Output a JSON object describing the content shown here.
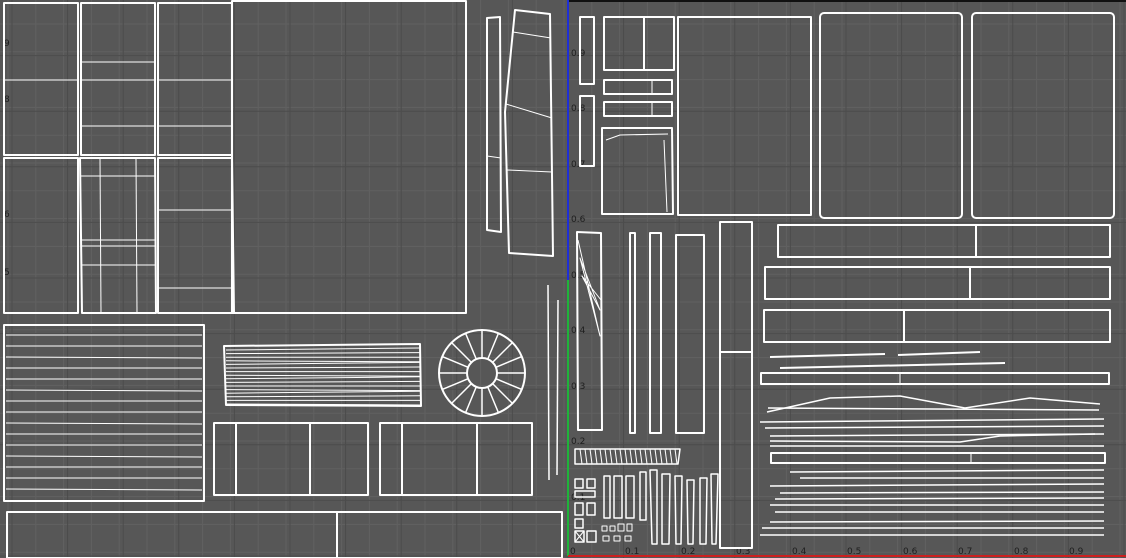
{
  "viewport": {
    "title": "",
    "colors": {
      "background": "#575757",
      "grid_minor": "#616161",
      "grid_major": "#4c4c4c",
      "uv_edges": "#ffffff",
      "u_axis": "#cc1f1f",
      "v_axis": "#1f2fd6",
      "v_axis_low": "#1fb33a",
      "tile_border": "#111111"
    },
    "u_ticks": [
      "0",
      "0.1",
      "0.2",
      "0.3",
      "0.4",
      "0.5",
      "0.6",
      "0.7",
      "0.8",
      "0.9"
    ],
    "v_ticks": [
      "0.1",
      "0.2",
      "0.3",
      "0.4",
      "0.5",
      "0.6",
      "0.7",
      "0.8",
      "0.9"
    ],
    "left_tile_v_ticks": [
      "9",
      "8",
      "6",
      "5"
    ]
  }
}
